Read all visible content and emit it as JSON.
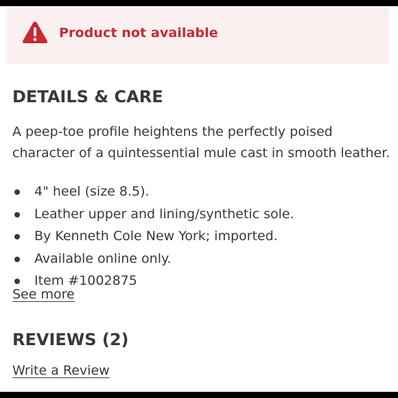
{
  "alert": {
    "icon": "warning-triangle-icon",
    "text": "Product not available",
    "color": "#c42b32",
    "background": "#fbf0f0"
  },
  "details": {
    "title": "DETAILS & CARE",
    "description": "A peep-toe profile heightens the perfectly poised character of a quintessential mule cast in smooth leather.",
    "bullets": [
      "4\" heel (size 8.5).",
      "Leather upper and lining/synthetic sole.",
      "By Kenneth Cole New York; imported.",
      "Available online only.",
      "Item #1002875"
    ],
    "see_more": "See more"
  },
  "reviews": {
    "title": "REVIEWS (2)",
    "write_review": "Write a Review"
  }
}
